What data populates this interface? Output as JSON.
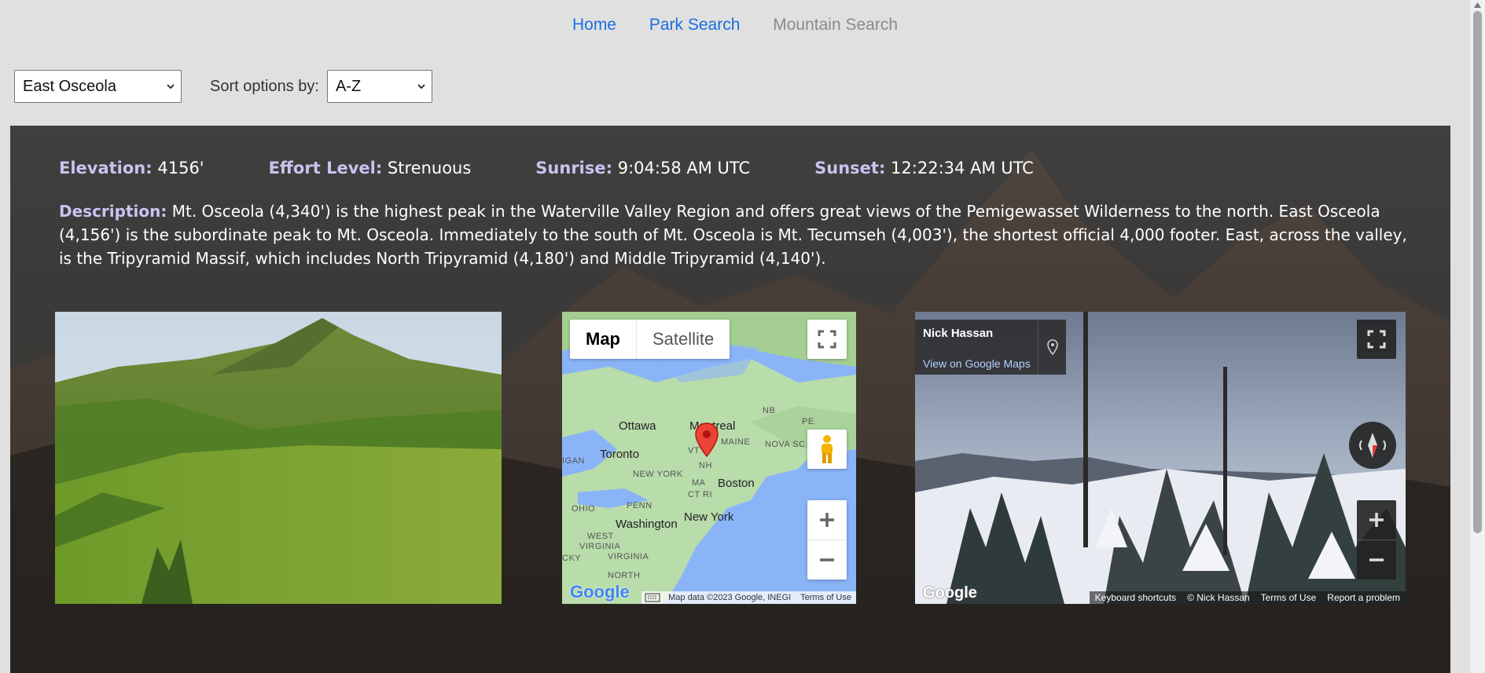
{
  "nav": {
    "items": [
      {
        "label": "Home",
        "current": false
      },
      {
        "label": "Park Search",
        "current": false
      },
      {
        "label": "Mountain Search",
        "current": true
      }
    ]
  },
  "controls": {
    "mountain_select": "East Osceola",
    "sort_label": "Sort options by:",
    "sort_select": "A-Z"
  },
  "stats": {
    "elevation_label": "Elevation:",
    "elevation_value": "4156'",
    "effort_label": "Effort Level:",
    "effort_value": "Strenuous",
    "sunrise_label": "Sunrise:",
    "sunrise_value": "9:04:58 AM UTC",
    "sunset_label": "Sunset:",
    "sunset_value": "12:22:34 AM UTC"
  },
  "description": {
    "label": "Description:",
    "text": "Mt. Osceola (4,340') is the highest peak in the Waterville Valley Region and offers great views of the Pemigewasset Wilderness to the north. East Osceola (4,156') is the subordinate peak to Mt. Osceola. Immediately to the south of Mt. Osceola is Mt. Tecumseh (4,003'), the shortest official 4,000 footer. East, across the valley, is the Tripyramid Massif, which includes North Tripyramid (4,180') and Middle Tripyramid (4,140')."
  },
  "map": {
    "toggle_map": "Map",
    "toggle_satellite": "Satellite",
    "labels": {
      "ottawa": "Ottawa",
      "montreal": "Montreal",
      "toronto": "Toronto",
      "boston": "Boston",
      "new_york_city": "New York",
      "washington": "Washington",
      "maine": "MAINE",
      "nb": "NB",
      "pe": "PE",
      "nova_scotia": "NOVA SC",
      "vt": "VT",
      "nh": "NH",
      "ny_state": "NEW YORK",
      "ma": "MA",
      "ct_ri": "CT RI",
      "penn": "PENN",
      "ohio": "OHIO",
      "west_virginia_1": "WEST",
      "west_virginia_2": "VIRGINIA",
      "virginia": "VIRGINIA",
      "north": "NORTH",
      "igan": "IGAN",
      "cky": "CKY"
    },
    "google": "Google",
    "footer_data": "Map data ©2023 Google, INEGI",
    "footer_terms": "Terms of Use"
  },
  "streetview": {
    "author": "Nick Hassan",
    "view_link": "View on Google Maps",
    "google": "Google",
    "footer": [
      "Keyboard shortcuts",
      "© Nick Hassan",
      "Terms of Use",
      "Report a problem"
    ]
  },
  "colors": {
    "link": "#1a6ee0",
    "current_nav": "#8a8a8a",
    "stat_label": "#c8c3f0",
    "panel_bg": "#3f3f3f"
  }
}
